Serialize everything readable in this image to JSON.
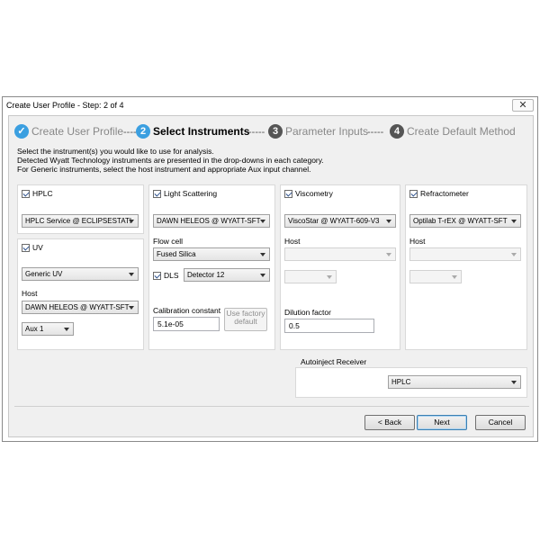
{
  "window": {
    "title": "Create User Profile - Step: 2 of 4",
    "close_glyph": "✕"
  },
  "steps": [
    {
      "number": "1",
      "label": "Create User Profile",
      "icon": "check-icon",
      "color": "#3b9fe0"
    },
    {
      "number": "2",
      "label": "Select Instruments",
      "color": "#3b9fe0"
    },
    {
      "number": "3",
      "label": "Parameter Inputs",
      "color": "#555555"
    },
    {
      "number": "4",
      "label": "Create Default Method",
      "color": "#555555"
    }
  ],
  "step_separator": "-----",
  "intro": [
    "Select the instrument(s) you would like to use for analysis.",
    "Detected Wyatt Technology instruments are presented in the drop-downs in each category.",
    "For Generic instruments, select the host instrument and appropriate Aux input channel."
  ],
  "hplc": {
    "label": "HPLC",
    "checked": true,
    "instrument": "HPLC Service @ ECLIPSESTATI"
  },
  "uv": {
    "label": "UV",
    "checked": true,
    "instrument": "Generic UV",
    "host_label": "Host",
    "host": "DAWN HELEOS @ WYATT-SFT",
    "aux": "Aux 1"
  },
  "light_scattering": {
    "label": "Light Scattering",
    "checked": true,
    "instrument": "DAWN HELEOS @ WYATT-SFT",
    "flow_cell_label": "Flow cell",
    "flow_cell": "Fused Silica",
    "dls_label": "DLS",
    "dls_checked": true,
    "detector": "Detector 12",
    "calibration_label": "Calibration constant",
    "calibration_value": "5.1e-05",
    "factory_default_label_1": "Use factory",
    "factory_default_label_2": "default"
  },
  "viscometry": {
    "label": "Viscometry",
    "checked": true,
    "instrument": "ViscoStar @ WYATT-609-V3",
    "host_label": "Host",
    "dilution_label": "Dilution factor",
    "dilution_value": "0.5"
  },
  "refractometer": {
    "label": "Refractometer",
    "checked": true,
    "instrument": "Optilab T-rEX @ WYATT-SFT",
    "host_label": "Host"
  },
  "autoinject": {
    "label": "Autoinject Receiver",
    "value": "HPLC"
  },
  "buttons": {
    "back": "< Back",
    "next": "Next",
    "cancel": "Cancel"
  }
}
